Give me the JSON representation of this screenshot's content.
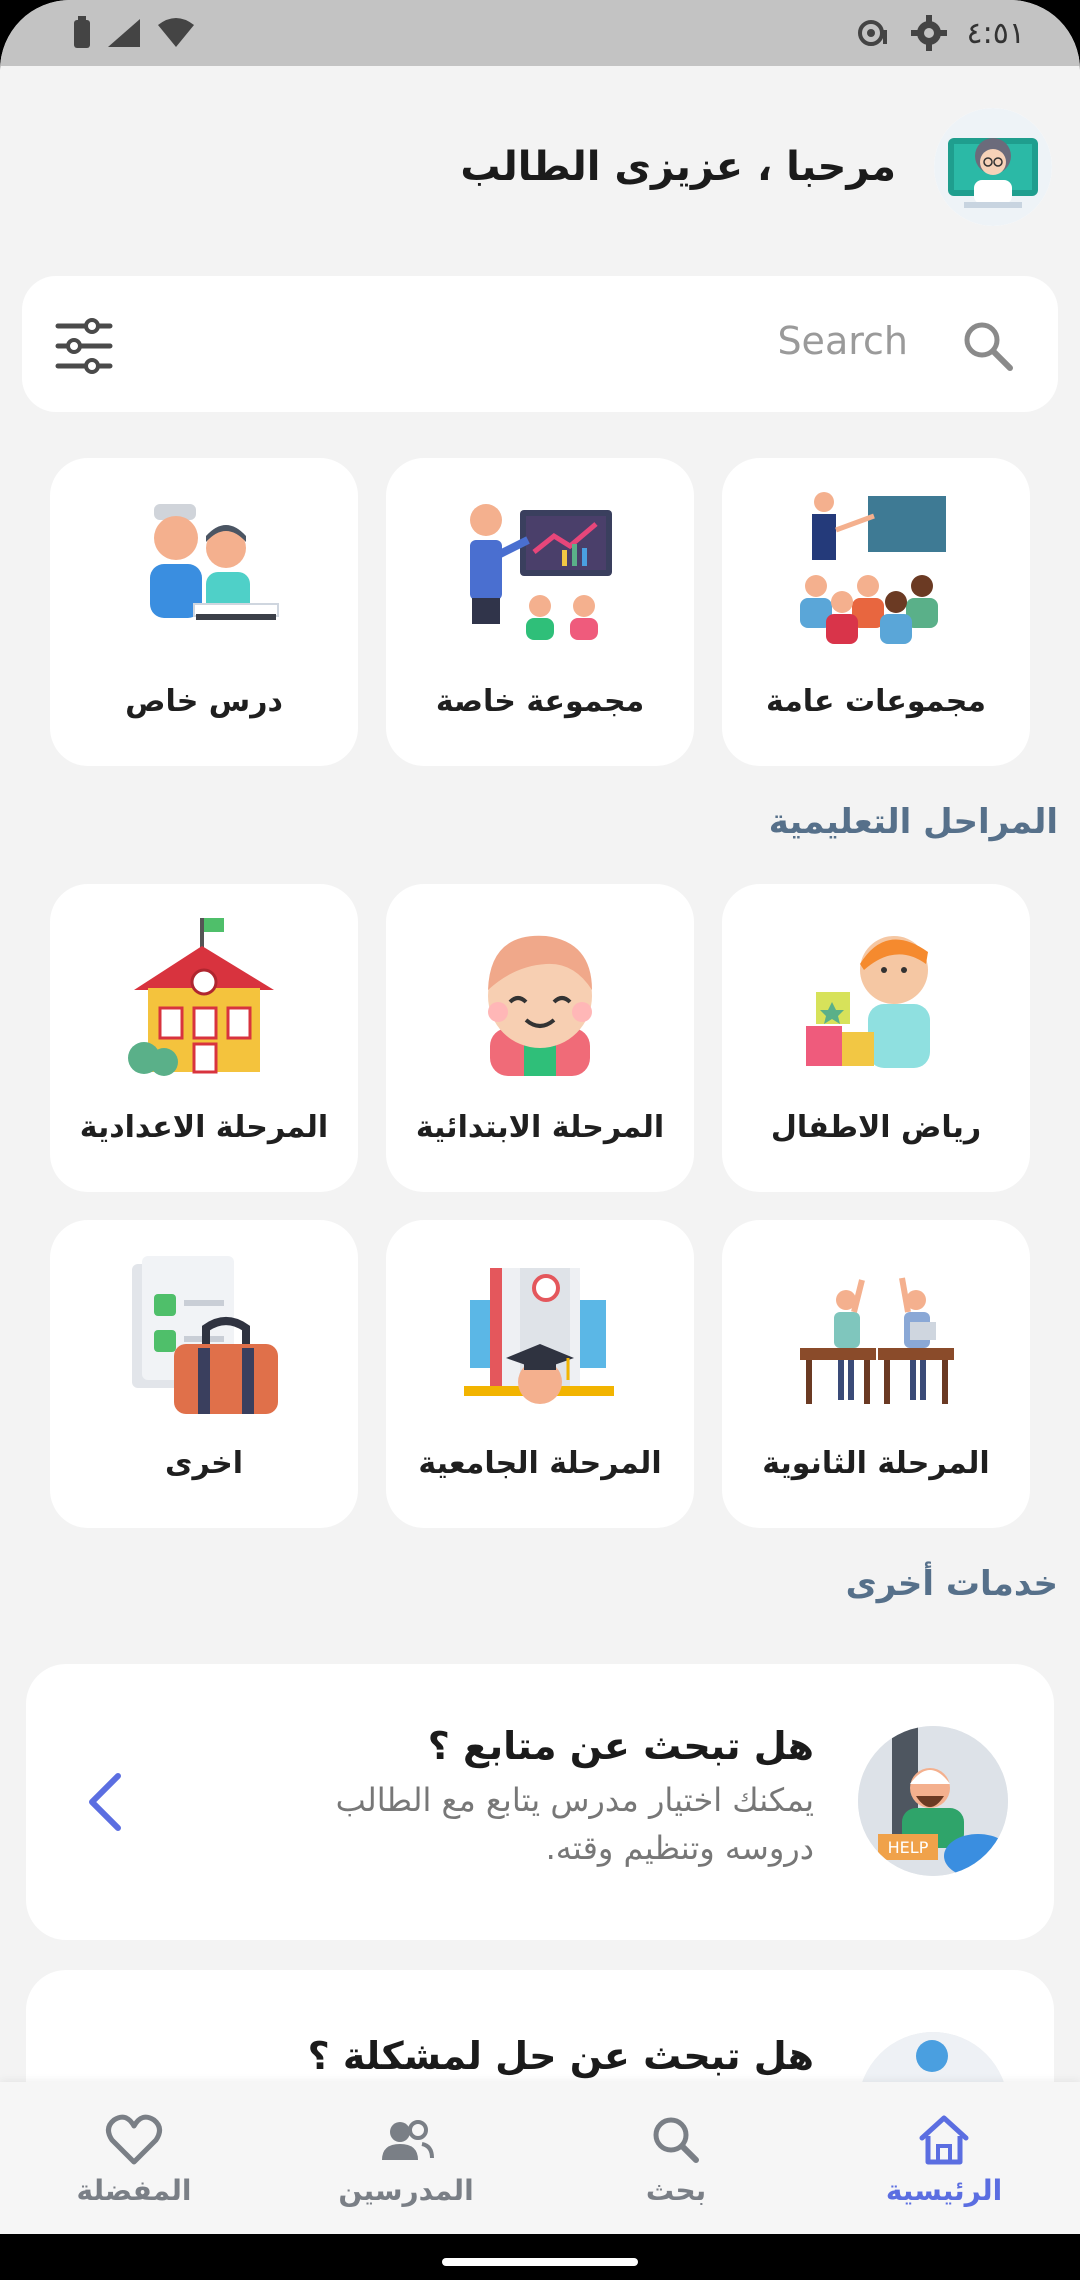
{
  "status_bar": {
    "time": "٤:٥١"
  },
  "header": {
    "greeting": "مرحبا ، عزيزى الطالب"
  },
  "search": {
    "placeholder": "Search"
  },
  "categories": [
    {
      "label": "مجموعات عامة",
      "icon": "classroom-group-icon"
    },
    {
      "label": "مجموعة خاصة",
      "icon": "private-group-icon"
    },
    {
      "label": "درس خاص",
      "icon": "private-lesson-icon"
    }
  ],
  "stages_title": "المراحل التعليمية",
  "stages": [
    {
      "label": "رياض الاطفال",
      "icon": "kindergarten-icon"
    },
    {
      "label": "المرحلة الابتدائية",
      "icon": "primary-stage-icon"
    },
    {
      "label": "المرحلة الاعدادية",
      "icon": "school-building-icon"
    },
    {
      "label": "المرحلة الثانوية",
      "icon": "secondary-students-icon"
    },
    {
      "label": "المرحلة الجامعية",
      "icon": "university-icon"
    },
    {
      "label": "اخرى",
      "icon": "other-bag-icon"
    }
  ],
  "services_title": "خدمات أخرى",
  "services": [
    {
      "title": "هل تبحث عن متابع ؟",
      "description": "يمكنك اختيار مدرس يتابع مع الطالب دروسه وتنظيم وقته."
    },
    {
      "title": "هل تبحث عن حل لمشكلة ؟"
    }
  ],
  "bottom_nav": [
    {
      "label": "الرئيسية",
      "icon": "home-icon",
      "active": true
    },
    {
      "label": "بحث",
      "icon": "search-icon",
      "active": false
    },
    {
      "label": "المدرسين",
      "icon": "teachers-icon",
      "active": false
    },
    {
      "label": "المفضلة",
      "icon": "heart-icon",
      "active": false
    }
  ],
  "colors": {
    "accent": "#5b6ee1",
    "inactive": "#7a7f86",
    "section": "#56708a",
    "background": "#f3f3f3"
  }
}
